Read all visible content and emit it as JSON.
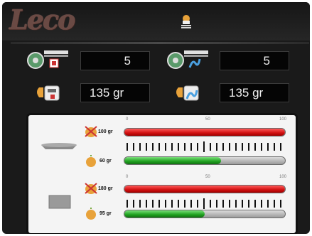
{
  "header": {
    "logo_text": "Leco",
    "status_icon": "chef-hat-icon"
  },
  "settings": {
    "count_left": "5",
    "count_right": "5",
    "weight_left": "135 gr",
    "weight_right": "135 gr"
  },
  "panel": {
    "scale_ticks": [
      "0",
      "50",
      "100"
    ],
    "rows": [
      {
        "item_icon": "tray-icon",
        "max_label": "100 gr",
        "cur_label": "60 gr",
        "max_fill": 1.0,
        "cur_fill": 0.6
      },
      {
        "item_icon": "block-icon",
        "max_label": "180 gr",
        "cur_label": "95 gr",
        "max_fill": 1.0,
        "cur_fill": 0.5
      }
    ]
  },
  "colors": {
    "red_bar": "#d01010",
    "green_bar": "#1ea01e",
    "background": "#1a1a1a"
  }
}
